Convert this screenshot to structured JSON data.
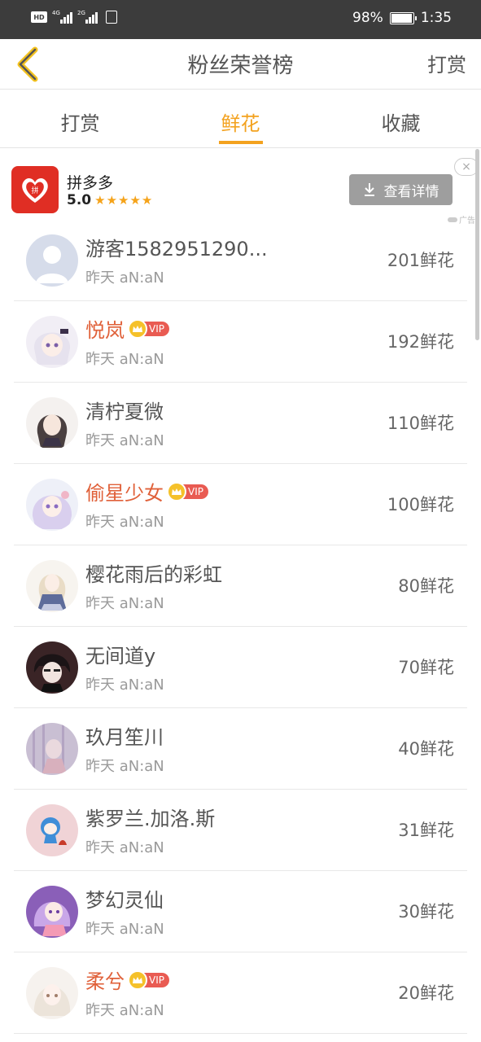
{
  "status_bar": {
    "hd": "HD",
    "net1": "4G",
    "net2": "2G",
    "battery": "98%",
    "battery_level": 0.98,
    "time": "1:35"
  },
  "title_bar": {
    "title": "粉丝荣誉榜",
    "right_button": "打赏"
  },
  "tabs": [
    {
      "label": "打赏",
      "active": false
    },
    {
      "label": "鲜花",
      "active": true
    },
    {
      "label": "收藏",
      "active": false
    }
  ],
  "ad": {
    "app_name": "拼多多",
    "rating": "5.0",
    "stars": "★★★★★",
    "button": "查看详情",
    "tag": "广告",
    "close": "×"
  },
  "fans": [
    {
      "name": "游客1582951290...",
      "vip": false,
      "time": "昨天 aN:aN",
      "count": "201鲜花",
      "avatar": "default-avatar"
    },
    {
      "name": "悦岚",
      "vip": true,
      "vip_label": "VIP",
      "time": "昨天 aN:aN",
      "count": "192鲜花",
      "avatar": "anime-girl-avatar"
    },
    {
      "name": "清柠夏微",
      "vip": false,
      "time": "昨天 aN:aN",
      "count": "110鲜花",
      "avatar": "anime-girl-avatar"
    },
    {
      "name": "偷星少女",
      "vip": true,
      "vip_label": "VIP",
      "time": "昨天 aN:aN",
      "count": "100鲜花",
      "avatar": "anime-girl-avatar"
    },
    {
      "name": "樱花雨后的彩虹",
      "vip": false,
      "time": "昨天 aN:aN",
      "count": "80鲜花",
      "avatar": "anime-girl-avatar"
    },
    {
      "name": "无间道y",
      "vip": false,
      "time": "昨天 aN:aN",
      "count": "70鲜花",
      "avatar": "anime-boy-avatar"
    },
    {
      "name": "玖月笙川",
      "vip": false,
      "time": "昨天 aN:aN",
      "count": "40鲜花",
      "avatar": "anime-girl-avatar"
    },
    {
      "name": "紫罗兰.加洛.斯",
      "vip": false,
      "time": "昨天 aN:aN",
      "count": "31鲜花",
      "avatar": "chibi-avatar"
    },
    {
      "name": "梦幻灵仙",
      "vip": false,
      "time": "昨天 aN:aN",
      "count": "30鲜花",
      "avatar": "anime-girl-avatar"
    },
    {
      "name": "柔兮",
      "vip": true,
      "vip_label": "VIP",
      "time": "昨天 aN:aN",
      "count": "20鲜花",
      "avatar": "anime-girl-avatar"
    }
  ],
  "colors": {
    "accent": "#f3a21f",
    "vip_name": "#e0613a",
    "vip_badge": "#e95b52",
    "status_bar": "#3c3c3c",
    "ad_logo": "#e02e24"
  }
}
